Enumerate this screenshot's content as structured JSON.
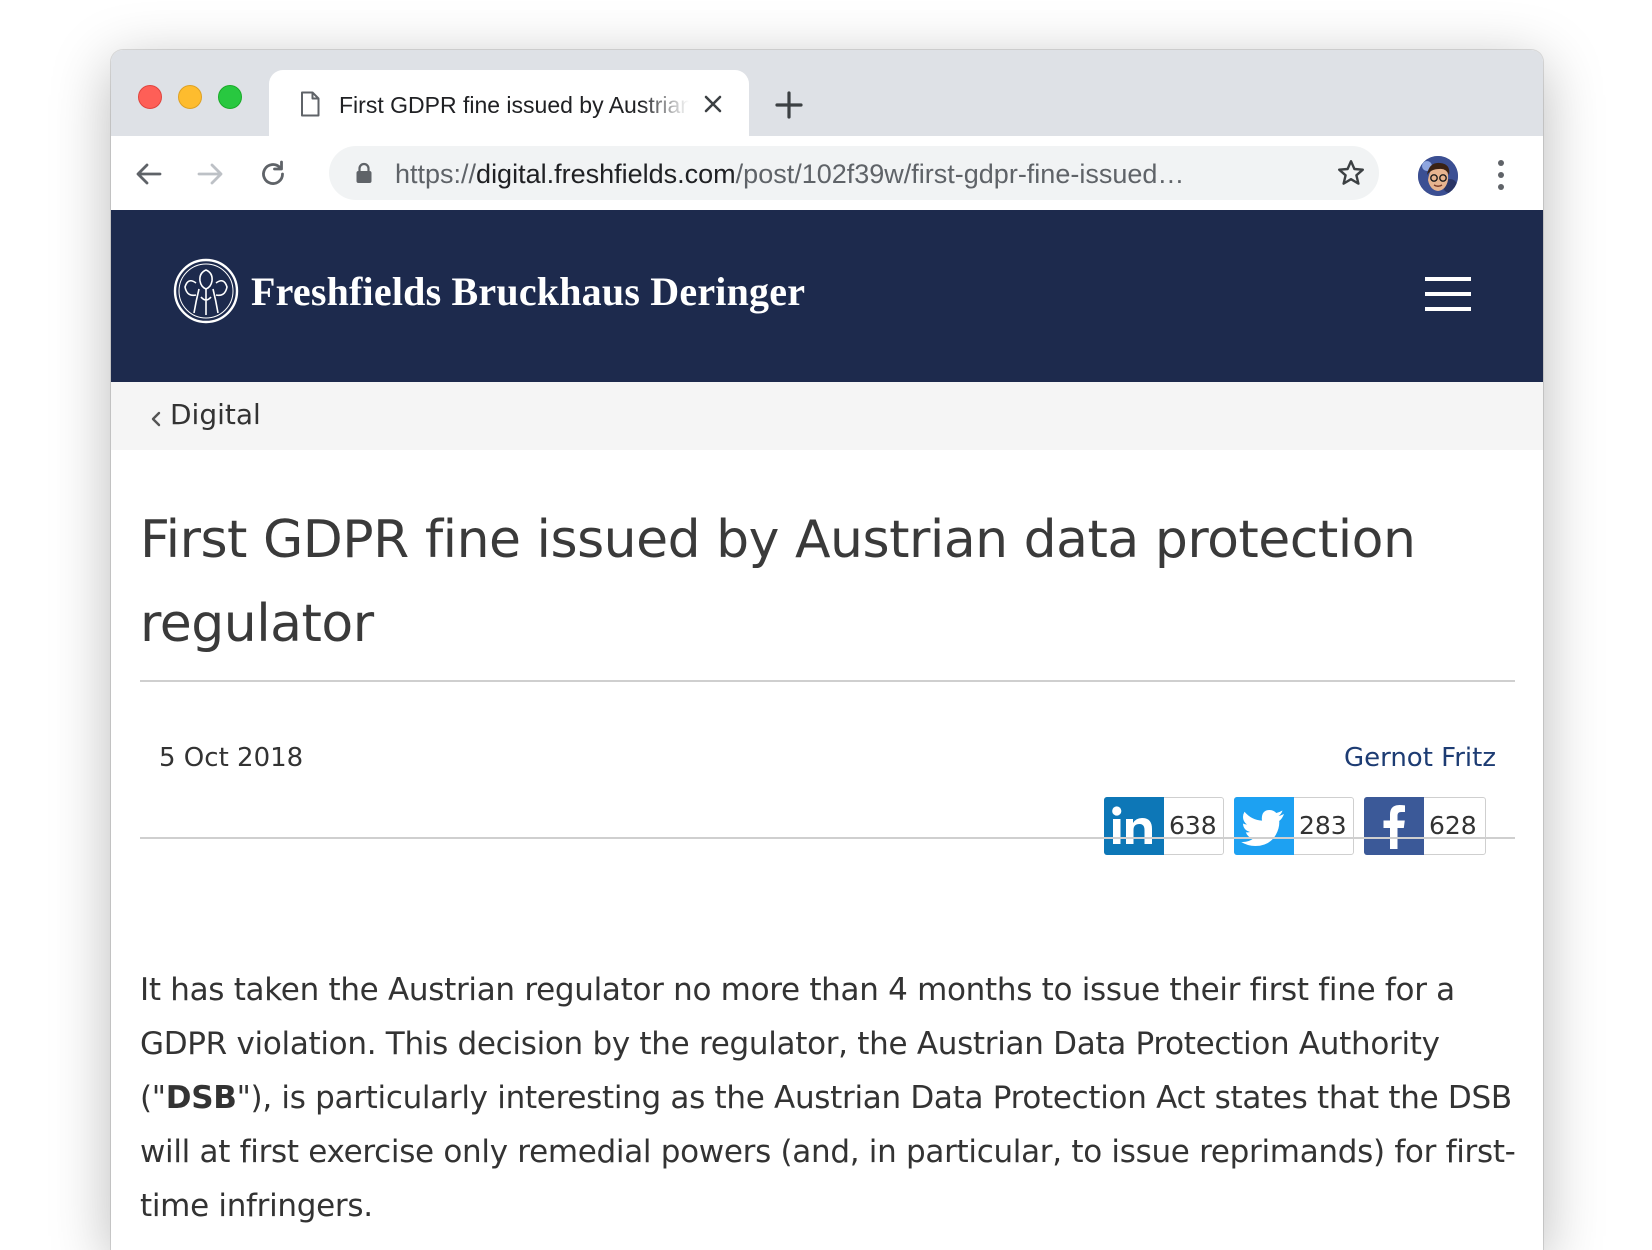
{
  "browser": {
    "tab_title": "First GDPR fine issued by Austrian data protection regulator",
    "url_scheme": "https://",
    "url_host": "digital.freshfields.com",
    "url_path": "/post/102f39w/first-gdpr-fine-issued…",
    "icons": [
      "document-icon",
      "close-icon",
      "plus-icon",
      "back-arrow-icon",
      "forward-arrow-icon",
      "reload-icon",
      "lock-icon",
      "star-icon",
      "avatar",
      "more-vert-icon"
    ]
  },
  "site": {
    "logo_text": "Freshfields Bruckhaus Deringer",
    "header_color": "#1d2a4d"
  },
  "breadcrumb": {
    "label": "Digital"
  },
  "article": {
    "title": "First GDPR fine issued by Austrian data protection regulator",
    "date": "5 Oct 2018",
    "author": "Gernot Fritz",
    "share": {
      "linkedin_count": "638",
      "twitter_count": "283",
      "facebook_count": "628",
      "linkedin_color": "#0d77b7",
      "twitter_color": "#1da1f2",
      "facebook_color": "#3b5998"
    },
    "body_part1": "It has taken the Austrian regulator no more than 4 months to issue their first fine for a GDPR violation. This decision by the regulator, the Austrian Data Protection Authority (\"",
    "body_bold": "DSB",
    "body_part2": "\"), is particularly interesting as the Austrian Data Protection Act states that the DSB will at first exercise only remedial powers (and, in particular, to issue reprimands) for first-time infringers."
  }
}
